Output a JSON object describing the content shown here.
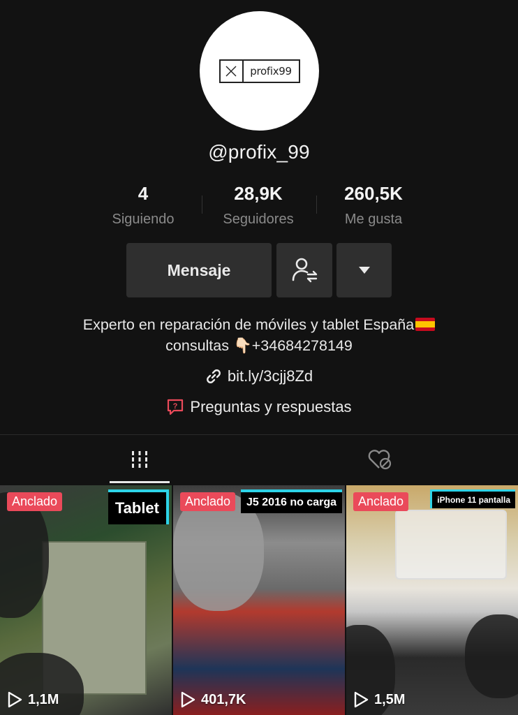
{
  "profile": {
    "avatar_logo_text": "profix99",
    "username": "@profix_99",
    "stats": [
      {
        "value": "4",
        "label": "Siguiendo"
      },
      {
        "value": "28,9K",
        "label": "Seguidores"
      },
      {
        "value": "260,5K",
        "label": "Me gusta"
      }
    ],
    "message_button": "Mensaje",
    "bio_line1": "Experto en reparación de móviles y tablet España",
    "bio_line2_prefix": "consultas ",
    "bio_line2_emoji": "👇🏻",
    "bio_line2_phone": "+34684278149",
    "link": "bit.ly/3cjj8Zd",
    "qa_label": "Preguntas y respuestas"
  },
  "tabs": [
    {
      "name": "videos",
      "icon": "grid-icon",
      "active": true
    },
    {
      "name": "liked",
      "icon": "heart-lock-icon",
      "active": false
    }
  ],
  "videos": [
    {
      "pinned_label": "Anclado",
      "overlay_text": "Tablet",
      "views": "1,1M"
    },
    {
      "pinned_label": "Anclado",
      "overlay_text": "J5 2016 no carga",
      "views": "401,7K"
    },
    {
      "pinned_label": "Anclado",
      "overlay_text": "iPhone 11 pantalla",
      "views": "1,5M"
    }
  ],
  "colors": {
    "background": "#121212",
    "accent_pin": "#ea4a5a",
    "button_bg": "#2f2f2f"
  }
}
